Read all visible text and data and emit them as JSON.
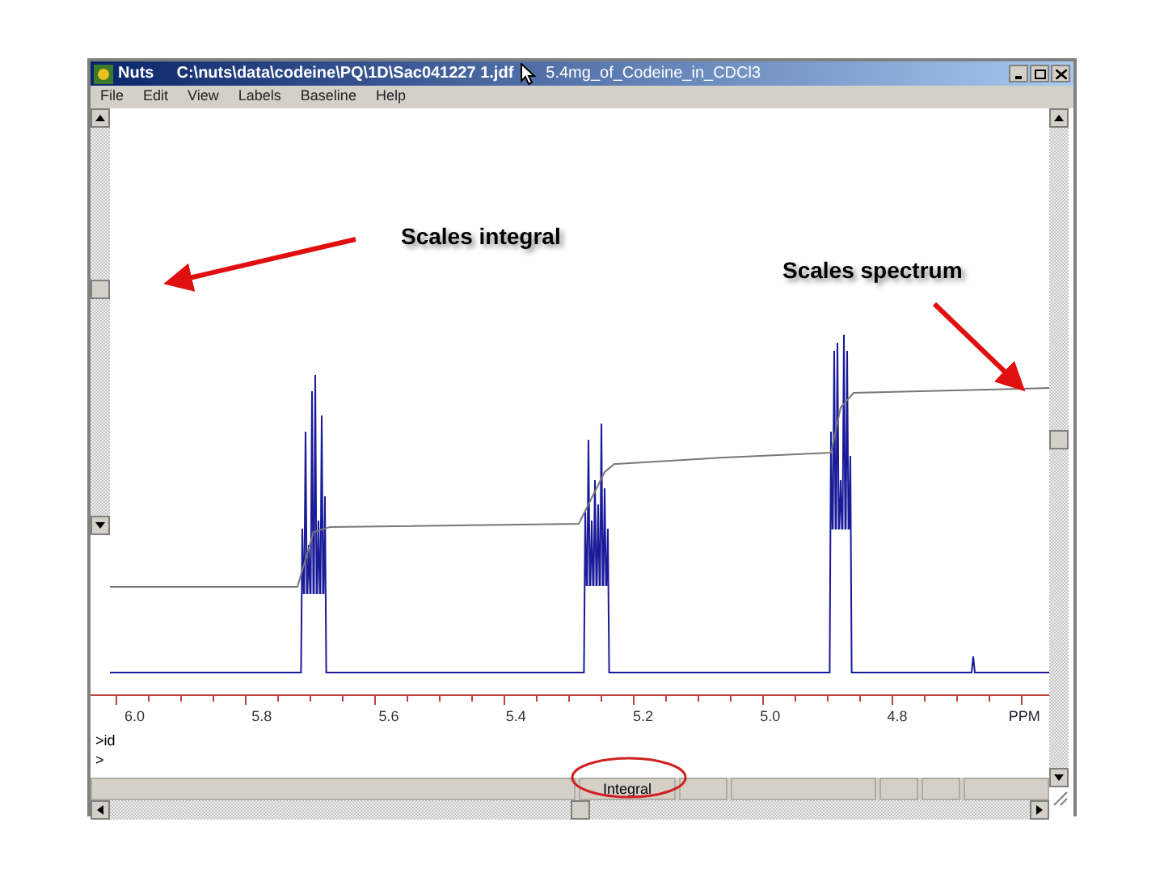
{
  "window": {
    "app_name": "Nuts",
    "file_path": "C:\\nuts\\data\\codeine\\PQ\\1D\\Sac041227 1.jdf",
    "sample": "5.4mg_of_Codeine_in_CDCl3"
  },
  "menu": [
    "File",
    "Edit",
    "View",
    "Labels",
    "Baseline",
    "Help"
  ],
  "axis": {
    "ticks": [
      "6.0",
      "5.8",
      "5.6",
      "5.4",
      "5.2",
      "5.0",
      "4.8"
    ],
    "unit": "PPM"
  },
  "command_lines": [
    ">id",
    ">"
  ],
  "status_bar": [
    "Integral"
  ],
  "annotations": [
    {
      "kind": "integral",
      "text": "Scales integral"
    },
    {
      "kind": "spectrum",
      "text": "Scales spectrum"
    }
  ]
}
